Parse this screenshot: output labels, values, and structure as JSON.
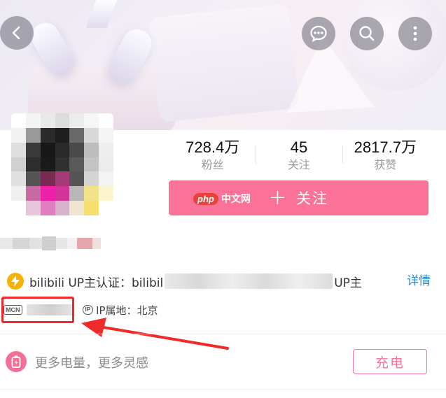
{
  "header": {
    "back_icon": "chevron-left-icon",
    "actions": [
      "message-icon",
      "search-icon",
      "more-vertical-icon"
    ]
  },
  "stats": [
    {
      "value": "728.4万",
      "label": "粉丝"
    },
    {
      "value": "45",
      "label": "关注"
    },
    {
      "value": "2817.7万",
      "label": "获赞"
    }
  ],
  "follow": {
    "plus": "+",
    "label": "关注",
    "color": "#fb7299"
  },
  "watermark": {
    "php": "php",
    "cn": "中文网"
  },
  "verification": {
    "icon": "lightning-bolt-icon",
    "prefix": "bilibili UP主认证：bilibil",
    "suffix": "UP主",
    "detail_link": "详情"
  },
  "meta": {
    "mcn_badge": "MCN",
    "ip_badge": "IP",
    "ip_location": "IP属地：北京"
  },
  "charge": {
    "icon": "battery-charge-icon",
    "tagline": "更多电量，更多灵感",
    "button": "充电"
  },
  "colors": {
    "accent": "#fb7299",
    "link": "#2a8bd1",
    "highlight_box": "#ee2a2a",
    "verified_gold": "#f6b200"
  }
}
